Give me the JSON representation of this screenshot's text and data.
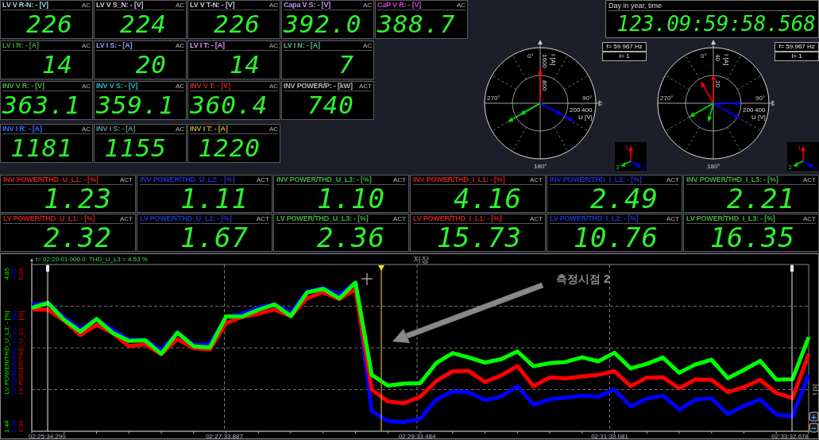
{
  "meter_rows": [
    {
      "cells": [
        {
          "label": "LV V R-N: - [V]",
          "tag": "AC",
          "value": "226",
          "color": "#a8d0e8"
        },
        {
          "label": "LV V S_N: - [V]",
          "tag": "AC",
          "value": "224",
          "color": "#c8c8d8"
        },
        {
          "label": "LV V T-N: - [V]",
          "tag": "AC",
          "value": "226",
          "color": "#c8c8d8"
        },
        {
          "label": "Capa V S: - [V]",
          "tag": "AC",
          "value": "392.0",
          "color": "#c890ff"
        },
        {
          "label": "CaP V R: - [V]",
          "tag": "AC",
          "value": "388.7",
          "color": "#d040d8"
        }
      ]
    },
    {
      "cells": [
        {
          "label": "LV I R: - [A]",
          "tag": "AC",
          "value": "14",
          "color": "#3c9a3c"
        },
        {
          "label": "LV I S: - [A]",
          "tag": "AC",
          "value": "20",
          "color": "#9898ff"
        },
        {
          "label": "LV I T: - [A]",
          "tag": "AC",
          "value": "14",
          "color": "#d898e8"
        },
        {
          "label": "LV I N: - [A]",
          "tag": "AC",
          "value": "7",
          "color": "#58b888"
        }
      ]
    },
    {
      "cells": [
        {
          "label": "INV V R: - [V]",
          "tag": "AC",
          "value": "363.1",
          "color": "#4cb040"
        },
        {
          "label": "INV V S: - [V]",
          "tag": "AC",
          "value": "359.1",
          "color": "#30b8c8"
        },
        {
          "label": "INV V T: - [V]",
          "tag": "AC",
          "value": "360.4",
          "color": "#d02828"
        },
        {
          "label": "INV POWER/P: - [kW]",
          "tag": "ACT",
          "value": "740",
          "color": "#b8b8b8"
        }
      ]
    },
    {
      "cells": [
        {
          "label": "INV I R: - [A]",
          "tag": "AC",
          "value": "1181",
          "color": "#3c6cff"
        },
        {
          "label": "INV I S: - [A]",
          "tag": "AC",
          "value": "1155",
          "color": "#5c9090"
        },
        {
          "label": "INV I T: - [A]",
          "tag": "AC",
          "value": "1220",
          "color": "#b8a838"
        }
      ]
    }
  ],
  "clock": {
    "label": "Day in year, time",
    "value": "123.09:59:58.568"
  },
  "phasors": [
    {
      "angle_labels": [
        "0°",
        "90°",
        "180°",
        "270°"
      ],
      "i_labels": [
        "1600",
        "800"
      ],
      "i_unit": "I [A]",
      "u_labels": [
        "200",
        "400"
      ],
      "u_unit": "U [V]",
      "frequency": "f= 59.967 Hz",
      "count": "I= 1",
      "legend": [
        "1",
        "2",
        "3"
      ]
    },
    {
      "angle_labels": [
        "0°",
        "90°",
        "180°",
        "270°"
      ],
      "i_labels": [
        "40",
        "20"
      ],
      "i_unit": "I [A]",
      "u_labels": [
        "200",
        "400"
      ],
      "u_unit": "U [V]",
      "frequency": "f= 59.967 Hz",
      "count": "I= 1",
      "legend": [
        "1",
        "2",
        "3"
      ]
    }
  ],
  "thd_meters": [
    {
      "label": "INV POWER/THD_U_L1: - [%]",
      "tag": "ACT",
      "value": "1.23",
      "color": "#d02020"
    },
    {
      "label": "INV POWER/THD_U_L2: - [%]",
      "tag": "ACT",
      "value": "1.11",
      "color": "#2030d0"
    },
    {
      "label": "INV POWER/THD_U_L3: - [%]",
      "tag": "ACT",
      "value": "1.10",
      "color": "#40b040"
    },
    {
      "label": "INV POWER/THD_I_L1: - [%]",
      "tag": "ACT",
      "value": "4.16",
      "color": "#d02020"
    },
    {
      "label": "INV POWER/THD_I_L2: - [%]",
      "tag": "ACT",
      "value": "2.49",
      "color": "#2030d0"
    },
    {
      "label": "INV POWER/THD_I_L3: - [%]",
      "tag": "ACT",
      "value": "2.21",
      "color": "#40b040"
    },
    {
      "label": "LV POWER/THD_U_L1: - [%]",
      "tag": "ACT",
      "value": "2.32",
      "color": "#d02020"
    },
    {
      "label": "LV POWER/THD_U_L2: - [%]",
      "tag": "ACT",
      "value": "1.67",
      "color": "#2030d0"
    },
    {
      "label": "LV POWER/THD_U_L3: - [%]",
      "tag": "ACT",
      "value": "2.36",
      "color": "#40b040"
    },
    {
      "label": "LV POWER/THD_I_L1: - [%]",
      "tag": "ACT",
      "value": "15.73",
      "color": "#d02020"
    },
    {
      "label": "LV POWER/THD_I_L2: - [%]",
      "tag": "ACT",
      "value": "10.76",
      "color": "#2030d0"
    },
    {
      "label": "LV POWER/THD_I_L3: - [%]",
      "tag": "ACT",
      "value": "16.35",
      "color": "#40b040"
    }
  ],
  "trend": {
    "cursor_readout": "t= 02:29:01.000.0: THD_U_L3 = 4.53 %",
    "save_label": "저장",
    "annotation": "측정시점 2",
    "time_axis_unit": "t [s]",
    "zoom_in": "+",
    "zoom_out": "−",
    "time_labels": [
      "02:25:34.290",
      "02:27:33.887",
      "02:29:33.484",
      "02:31:33.081",
      "02:33:32.678"
    ],
    "y_axes": [
      {
        "name": "LV POWER/THD_U_L3: - [%]",
        "color": "#00ff00",
        "max": "4.85",
        "min": "1.44"
      },
      {
        "name": "LV POWER/THD_U_L2: - [%]",
        "color": "#0000ff",
        "max": "4.35",
        "min": "1.28"
      },
      {
        "name": "LV POWER/THD_U_L1: - [%]",
        "color": "#ff0000",
        "max": "6.09",
        "min": "1.39"
      }
    ]
  }
}
